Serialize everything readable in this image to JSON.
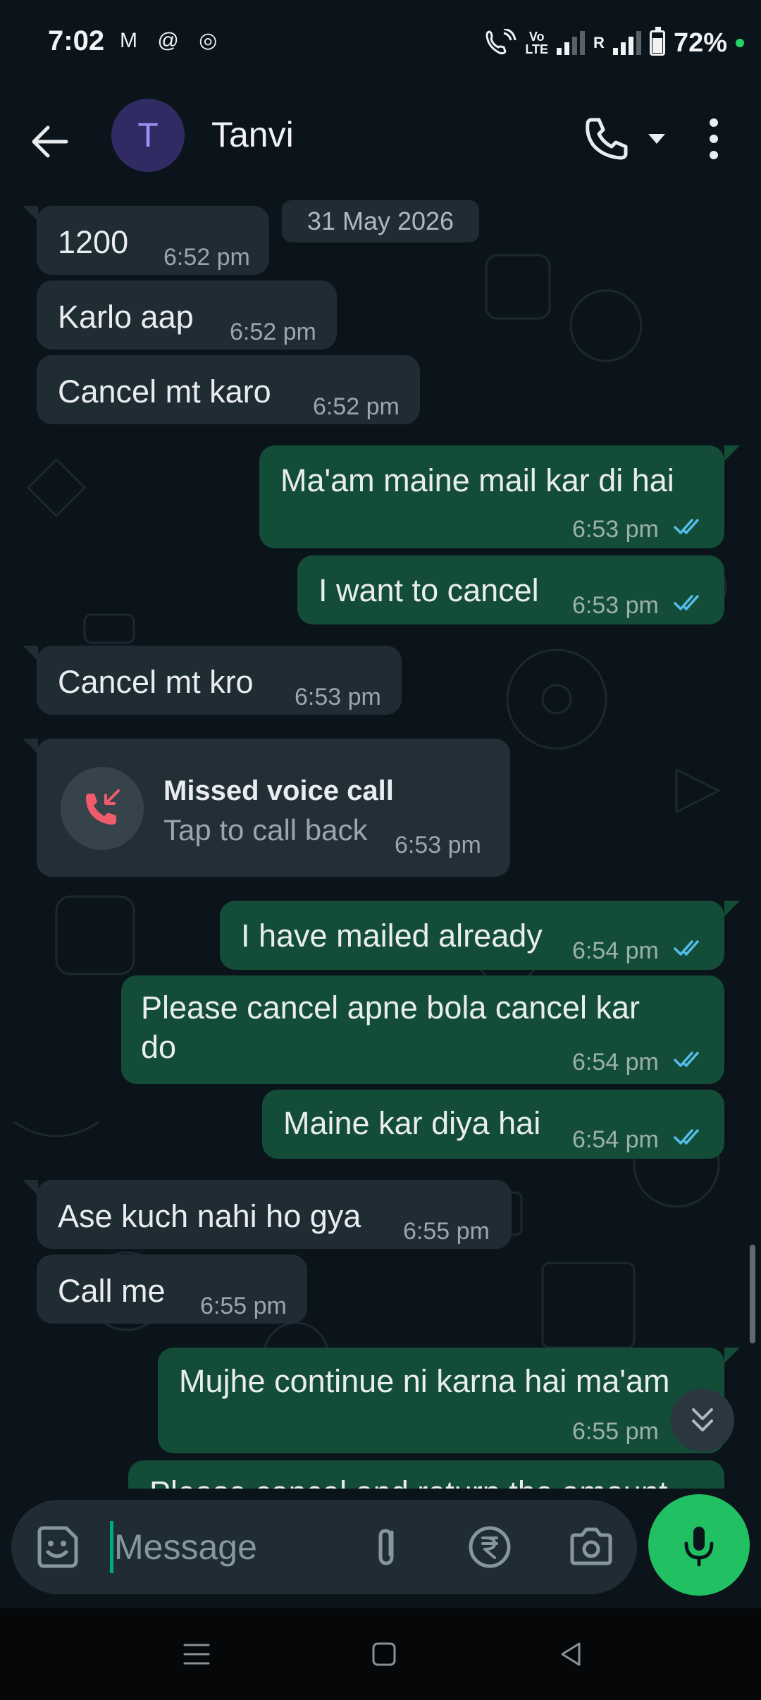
{
  "status_bar": {
    "time": "7:02",
    "left_icons": [
      "gmail-icon",
      "threads-icon",
      "chrome-icon"
    ],
    "wifi_call_label": "Vo",
    "lte_label": "LTE",
    "roaming_label": "R",
    "battery_percent": "72%"
  },
  "header": {
    "avatar_letter": "T",
    "contact_name": "Tanvi"
  },
  "chat": {
    "date_chip": "31 May 2026",
    "messages": [
      {
        "dir": "in",
        "text": "1200",
        "time": "6:52 pm"
      },
      {
        "dir": "in",
        "text": "Karlo aap",
        "time": "6:52 pm"
      },
      {
        "dir": "in",
        "text": "Cancel mt karo",
        "time": "6:52 pm"
      },
      {
        "dir": "out",
        "text": "Ma'am maine mail kar di hai",
        "time": "6:53 pm",
        "status": "read"
      },
      {
        "dir": "out",
        "text": "I want to cancel",
        "time": "6:53 pm",
        "status": "read"
      },
      {
        "dir": "in",
        "text": "Cancel mt kro",
        "time": "6:53 pm"
      },
      {
        "dir": "out",
        "text": "I have mailed already",
        "time": "6:54 pm",
        "status": "read"
      },
      {
        "dir": "out",
        "text_line1": "Please cancel apne bola cancel kar",
        "text_line2": "do",
        "time": "6:54 pm",
        "status": "read"
      },
      {
        "dir": "out",
        "text": "Maine kar diya hai",
        "time": "6:54 pm",
        "status": "read"
      },
      {
        "dir": "in",
        "text": "Ase kuch nahi ho gya",
        "time": "6:55 pm"
      },
      {
        "dir": "in",
        "text": "Call me",
        "time": "6:55 pm"
      },
      {
        "dir": "out",
        "text": "Mujhe continue ni karna hai ma'am",
        "time": "6:55 pm"
      },
      {
        "dir": "out",
        "text": "Please cancel and return the amount"
      }
    ],
    "missed_call": {
      "title": "Missed voice call",
      "subtitle": "Tap to call back",
      "time": "6:53 pm"
    }
  },
  "input": {
    "placeholder": "Message"
  },
  "colors": {
    "background": "#0b141a",
    "incoming_bubble": "#1f2c34",
    "outgoing_bubble": "#144d37",
    "read_ticks": "#53bdeb",
    "mic_button": "#21c063",
    "missed_call": "#f15c6d"
  }
}
